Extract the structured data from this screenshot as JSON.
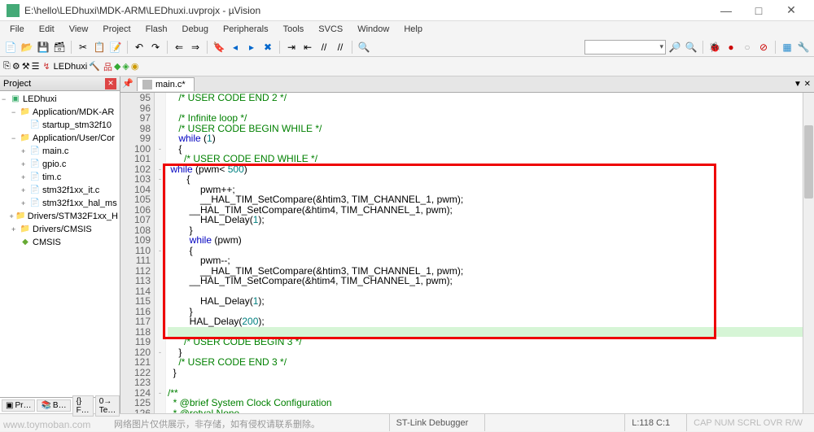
{
  "window": {
    "title": "E:\\hello\\LEDhuxi\\MDK-ARM\\LEDhuxi.uvprojx - µVision",
    "min": "—",
    "max": "□",
    "close": "✕"
  },
  "menu": [
    "File",
    "Edit",
    "View",
    "Project",
    "Flash",
    "Debug",
    "Peripherals",
    "Tools",
    "SVCS",
    "Window",
    "Help"
  ],
  "toolbar2": {
    "target": "LEDhuxi"
  },
  "project": {
    "title": "Project",
    "root": "LEDhuxi",
    "nodes": [
      {
        "l": 1,
        "tw": "−",
        "ic": "folder",
        "label": "Application/MDK-AR"
      },
      {
        "l": 2,
        "tw": "",
        "ic": "file",
        "label": "startup_stm32f10"
      },
      {
        "l": 1,
        "tw": "−",
        "ic": "folder",
        "label": "Application/User/Cor"
      },
      {
        "l": 2,
        "tw": "+",
        "ic": "file",
        "label": "main.c"
      },
      {
        "l": 2,
        "tw": "+",
        "ic": "file",
        "label": "gpio.c"
      },
      {
        "l": 2,
        "tw": "+",
        "ic": "file",
        "label": "tim.c"
      },
      {
        "l": 2,
        "tw": "+",
        "ic": "file",
        "label": "stm32f1xx_it.c"
      },
      {
        "l": 2,
        "tw": "+",
        "ic": "file",
        "label": "stm32f1xx_hal_ms"
      },
      {
        "l": 1,
        "tw": "+",
        "ic": "folder",
        "label": "Drivers/STM32F1xx_H"
      },
      {
        "l": 1,
        "tw": "+",
        "ic": "folder",
        "label": "Drivers/CMSIS"
      },
      {
        "l": 1,
        "tw": "",
        "ic": "diamond",
        "label": "CMSIS"
      }
    ],
    "tabs": [
      "Pr…",
      "B…",
      "{} F…",
      "0→ Te…"
    ]
  },
  "editor": {
    "tab": "main.c*",
    "lines": [
      {
        "n": 95,
        "f": "",
        "t": "    /* USER CODE END 2 */",
        "cls": "c-cm"
      },
      {
        "n": 96,
        "f": "",
        "t": "",
        "cls": ""
      },
      {
        "n": 97,
        "f": "",
        "t": "    /* Infinite loop */",
        "cls": "c-cm"
      },
      {
        "n": 98,
        "f": "",
        "t": "    /* USER CODE BEGIN WHILE */",
        "cls": "c-cm"
      },
      {
        "n": 99,
        "f": "",
        "t": "    <span class=c-kw>while</span> (<span class=c-num>1</span>)",
        "cls": ""
      },
      {
        "n": 100,
        "f": "-",
        "t": "    {",
        "cls": ""
      },
      {
        "n": 101,
        "f": "",
        "t": "      /* USER CODE END WHILE */",
        "cls": "c-cm"
      },
      {
        "n": 102,
        "f": "-",
        "t": " <span class=c-kw>while</span> (pwm&lt; <span class=c-num>500</span>)",
        "cls": ""
      },
      {
        "n": 103,
        "f": "-",
        "t": "       {",
        "cls": ""
      },
      {
        "n": 104,
        "f": "",
        "t": "            pwm++;",
        "cls": ""
      },
      {
        "n": 105,
        "f": "",
        "t": "            __HAL_TIM_SetCompare(&amp;htim3, TIM_CHANNEL_1, pwm);",
        "cls": ""
      },
      {
        "n": 106,
        "f": "",
        "t": "        __HAL_TIM_SetCompare(&amp;htim4, TIM_CHANNEL_1, pwm);",
        "cls": ""
      },
      {
        "n": 107,
        "f": "",
        "t": "            HAL_Delay(<span class=c-num>1</span>);",
        "cls": ""
      },
      {
        "n": 108,
        "f": "",
        "t": "        }",
        "cls": ""
      },
      {
        "n": 109,
        "f": "",
        "t": "        <span class=c-kw>while</span> (pwm)",
        "cls": ""
      },
      {
        "n": 110,
        "f": "-",
        "t": "        {",
        "cls": ""
      },
      {
        "n": 111,
        "f": "",
        "t": "            pwm--;",
        "cls": ""
      },
      {
        "n": 112,
        "f": "",
        "t": "            __HAL_TIM_SetCompare(&amp;htim3, TIM_CHANNEL_1, pwm);",
        "cls": ""
      },
      {
        "n": 113,
        "f": "",
        "t": "        __HAL_TIM_SetCompare(&amp;htim4, TIM_CHANNEL_1, pwm);",
        "cls": ""
      },
      {
        "n": 114,
        "f": "",
        "t": "",
        "cls": ""
      },
      {
        "n": 115,
        "f": "",
        "t": "            HAL_Delay(<span class=c-num>1</span>);",
        "cls": ""
      },
      {
        "n": 116,
        "f": "",
        "t": "        }",
        "cls": ""
      },
      {
        "n": 117,
        "f": "",
        "t": "        HAL_Delay(<span class=c-num>200</span>);",
        "cls": ""
      },
      {
        "n": 118,
        "f": "",
        "t": "<span class=c-hl> </span>",
        "cls": ""
      },
      {
        "n": 119,
        "f": "",
        "t": "      /* USER CODE BEGIN 3 */",
        "cls": "c-cm"
      },
      {
        "n": 120,
        "f": "-",
        "t": "    }",
        "cls": ""
      },
      {
        "n": 121,
        "f": "",
        "t": "    /* USER CODE END 3 */",
        "cls": "c-cm"
      },
      {
        "n": 122,
        "f": "",
        "t": "  }",
        "cls": ""
      },
      {
        "n": 123,
        "f": "",
        "t": "",
        "cls": ""
      },
      {
        "n": 124,
        "f": "-",
        "t": "/**",
        "cls": "c-cm"
      },
      {
        "n": 125,
        "f": "",
        "t": "  * @brief System Clock Configuration",
        "cls": "c-cm"
      },
      {
        "n": 126,
        "f": "",
        "t": "  * @retval None",
        "cls": "c-cm"
      }
    ]
  },
  "status": {
    "debugger": "ST-Link Debugger",
    "pos": "L:118 C:1",
    "caps": "CAP NUM SCRL OVR R/W"
  },
  "watermark": {
    "host": "www.toymoban.com",
    "note": "网络图片仅供展示，非存储，如有侵权请联系删除。"
  }
}
